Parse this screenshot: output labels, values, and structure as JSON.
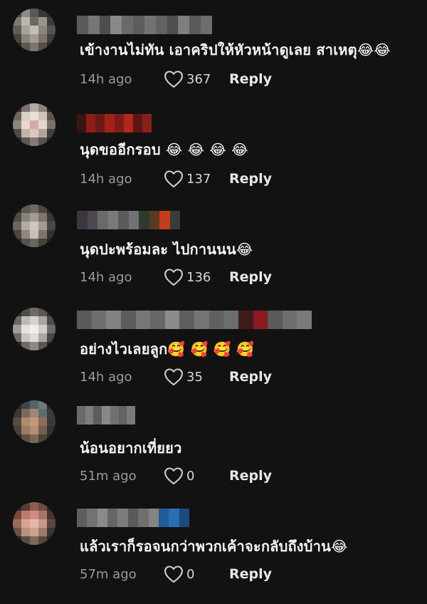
{
  "comments": [
    {
      "text": "เข้างานไม่ทัน เอาคริปให้หัวหน้าดูเลย สาเหตุ😂😂",
      "time": "14h ago",
      "likes": "367",
      "reply": "Reply",
      "avatar_colors": [
        "#4a4a48",
        "#8d8a86",
        "#5a5755",
        "#3a3836",
        "#2c2b2a",
        "#7b7874",
        "#b9b4ae",
        "#6c6863",
        "#9a958f",
        "#3f3d3b",
        "#605c58",
        "#a7a19a",
        "#c6bfb6",
        "#8a847e",
        "#57534f",
        "#48453f",
        "#8a837b",
        "#a69d92",
        "#7a736b",
        "#403d39",
        "#2b2a28",
        "#5c5852",
        "#7c766e",
        "#534f4a",
        "#2a2927"
      ],
      "name_colors": [
        "#5a5a5a",
        "#767676",
        "#4c4c4c",
        "#888888",
        "#6a6a6a",
        "#5d5d5d",
        "#727272",
        "#616161",
        "#4e4e4e",
        "#7f7f7f",
        "#5a5a5a",
        "#6d6d6d"
      ]
    },
    {
      "text": "นุดขออีกรอบ 😂 😂 😂 😂",
      "time": "14h ago",
      "likes": "137",
      "reply": "Reply",
      "avatar_colors": [
        "#2f2d2c",
        "#7a726d",
        "#b4aaa3",
        "#8c837d",
        "#2b2a29",
        "#6e655f",
        "#d8cec6",
        "#e8ded6",
        "#cfc3ba",
        "#5e5751",
        "#8e847d",
        "#e6d8d0",
        "#d8a8a0",
        "#e4d6cc",
        "#7c736c",
        "#514b47",
        "#bfb3aa",
        "#d7c9bf",
        "#b2a69c",
        "#433f3b",
        "#2a2928",
        "#5d5752",
        "#847a73",
        "#58524d",
        "#2a2928"
      ],
      "name_colors": [
        "#3a1512",
        "#8e1d17",
        "#6a1a15",
        "#a22219",
        "#7c1c16",
        "#b3261c",
        "#5e1613",
        "#8a1f18"
      ]
    },
    {
      "text": "นุดปะพร้อมละ ไปกานนน😂",
      "time": "14h ago",
      "likes": "136",
      "reply": "Reply",
      "avatar_colors": [
        "#2b2a29",
        "#5d5854",
        "#6f6862",
        "#4c4743",
        "#2a2928",
        "#4f4a46",
        "#8a837c",
        "#a49b93",
        "#7c746e",
        "#3a3734",
        "#6c655f",
        "#b2aaa1",
        "#d0c8c0",
        "#a39a91",
        "#4b4743",
        "#4b4642",
        "#8e8780",
        "#c8c0b8",
        "#7d766f",
        "#33302e",
        "#2a2928",
        "#57524d",
        "#6d6660",
        "#46423e",
        "#2a2928"
      ],
      "name_colors": [
        "#3d3540",
        "#4f4852",
        "#6a6a6a",
        "#7a7a7a",
        "#5a5a5a",
        "#727272",
        "#2f3a2f",
        "#5a3a1e",
        "#c33c1c",
        "#3b3b3b"
      ]
    },
    {
      "text": "อย่างไวเลยลูก🥰 🥰 🥰 🥰",
      "time": "14h ago",
      "likes": "35",
      "reply": "Reply",
      "avatar_colors": [
        "#2a2928",
        "#4f4c4a",
        "#6e6a67",
        "#5a5754",
        "#2a2928",
        "#6a6764",
        "#bdb9b5",
        "#d6d2ce",
        "#a9a5a1",
        "#4e4b48",
        "#a19d99",
        "#e6e2de",
        "#f2eeea",
        "#d2cec9",
        "#6f6b67",
        "#6d6965",
        "#c9c5c0",
        "#e0dcd8",
        "#aaa6a1",
        "#4a4744",
        "#2a2928",
        "#6e6a66",
        "#8c8884",
        "#5b5854",
        "#2a2928"
      ],
      "name_colors": [
        "#5a5a5a",
        "#6e6e6e",
        "#828282",
        "#5c5c5c",
        "#777777",
        "#686868",
        "#8c8c8c",
        "#5e5e5e",
        "#747474",
        "#616161",
        "#6d6d6d",
        "#3e1c1e",
        "#8c1a22",
        "#5a5a5a",
        "#6f6f6f",
        "#7a7a7a"
      ]
    },
    {
      "text": "น้อนอยากเที่ยยว",
      "time": "51m ago",
      "likes": "0",
      "reply": "Reply",
      "avatar_colors": [
        "#2a2928",
        "#3b4848",
        "#55636a",
        "#6c7a82",
        "#2a2928",
        "#3a3532",
        "#7a6a5c",
        "#a08672",
        "#5f6c70",
        "#3a3a38",
        "#5a4a3e",
        "#b08a6c",
        "#c4987a",
        "#8a6e5a",
        "#3d3834",
        "#48403a",
        "#9a7c64",
        "#b48e72",
        "#72604f",
        "#33302d",
        "#2a2928",
        "#5e5046",
        "#7c6858",
        "#4e443c",
        "#2a2928"
      ],
      "name_colors": [
        "#6a6a6a",
        "#7e7e7e",
        "#5e5e5e",
        "#888888",
        "#707070",
        "#636363",
        "#7a7a7a"
      ]
    },
    {
      "text": "แล้วเราก็รอจนกว่าพวกเค้าจะกลับถึงบ้าน😂",
      "time": "57m ago",
      "likes": "0",
      "reply": "Reply",
      "avatar_colors": [
        "#2a2928",
        "#5a3a36",
        "#8a5c52",
        "#6e4a44",
        "#2a2928",
        "#7a4640",
        "#c07a6c",
        "#cc8e80",
        "#a8746a",
        "#4a3532",
        "#9a6a5e",
        "#d6a496",
        "#e2b8a8",
        "#c89888",
        "#5e4640",
        "#6e5048",
        "#b8907e",
        "#caa490",
        "#9a7c6c",
        "#3e332f",
        "#2a2928",
        "#5c4a42",
        "#7e685c",
        "#56463e",
        "#2a2928"
      ],
      "name_colors": [
        "#5e5e5e",
        "#727272",
        "#8a8a8a",
        "#666666",
        "#7c7c7c",
        "#5a5a5a",
        "#707070",
        "#848484",
        "#1e5c9c",
        "#2a6eb4",
        "#1a4a7e"
      ]
    }
  ]
}
